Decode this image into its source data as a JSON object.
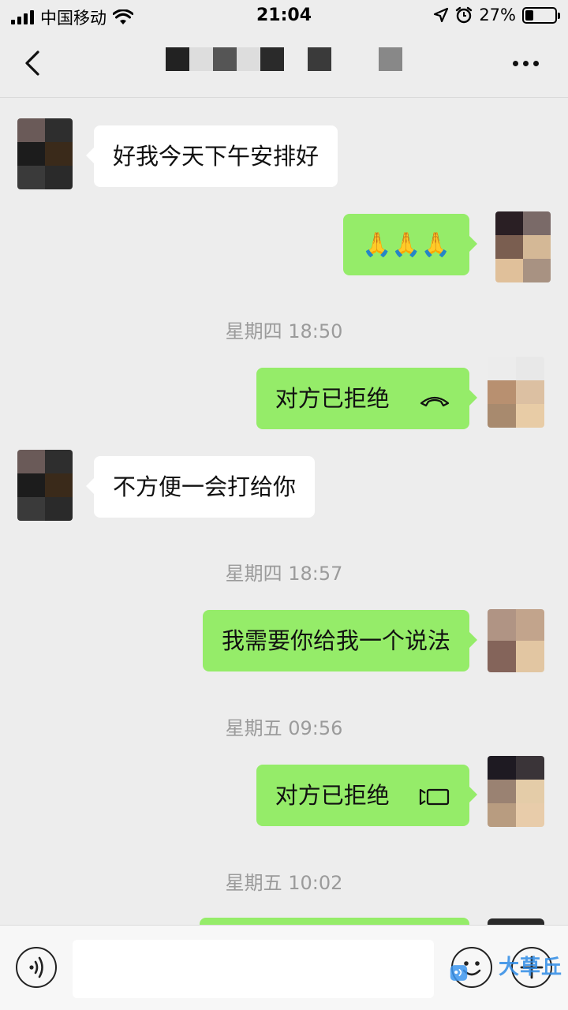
{
  "status_bar": {
    "carrier": "中国移动",
    "time": "21:04",
    "battery": "27%",
    "battery_level": 0.27
  },
  "nav": {
    "back_icon": "chevron-left-icon",
    "more_icon": "more-dots-icon"
  },
  "messages": [
    {
      "side": "left",
      "text": "好我今天下午安排好"
    },
    {
      "side": "right",
      "text": "🙏🙏🙏"
    },
    {
      "type": "time",
      "text": "星期四 18:50"
    },
    {
      "side": "right",
      "text": "对方已拒绝",
      "icon": "phone-hangup-icon"
    },
    {
      "side": "left",
      "text": "不方便一会打给你"
    },
    {
      "type": "time",
      "text": "星期四 18:57"
    },
    {
      "side": "right",
      "text": "我需要你给我一个说法"
    },
    {
      "type": "time",
      "text": "星期五 09:56"
    },
    {
      "side": "right",
      "text": "对方已拒绝",
      "icon": "video-call-icon"
    },
    {
      "type": "time",
      "text": "星期五 10:02"
    }
  ],
  "input": {
    "voice_icon": "voice-icon",
    "emoji_icon": "emoji-icon",
    "plus_icon": "plus-icon",
    "placeholder": ""
  },
  "watermark": {
    "text": "大草丘"
  }
}
